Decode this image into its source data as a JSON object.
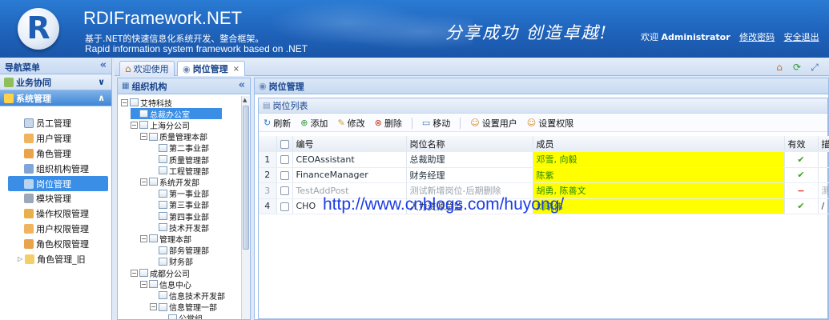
{
  "header": {
    "logo_letter": "R",
    "title": "RDIFramework.NET",
    "subtitle_cn": "基于.NET的快速信息化系统开发、整合框架。",
    "subtitle_en": "Rapid information system framework based on .NET",
    "slogan": "分享成功  创造卓越!",
    "welcome": "欢迎",
    "username": "Administrator",
    "change_password": "修改密码",
    "logout": "安全退出",
    "color": "#1f63bb"
  },
  "nav": {
    "title": "导航菜单",
    "collapse": "«",
    "groups": [
      {
        "label": "业务协同",
        "chev": "∨"
      },
      {
        "label": "系统管理",
        "chev": "∧"
      }
    ],
    "items": [
      {
        "label": "员工管理",
        "icon": "user-icon"
      },
      {
        "label": "用户管理",
        "icon": "user-icon"
      },
      {
        "label": "角色管理",
        "icon": "role-icon"
      },
      {
        "label": "组织机构管理",
        "icon": "org-icon"
      },
      {
        "label": "岗位管理",
        "icon": "post-icon"
      },
      {
        "label": "模块管理",
        "icon": "module-icon"
      },
      {
        "label": "操作权限管理",
        "icon": "permission-icon"
      },
      {
        "label": "用户权限管理",
        "icon": "user-icon"
      },
      {
        "label": "角色权限管理",
        "icon": "role-icon"
      },
      {
        "label": "角色管理_旧",
        "icon": "folder-icon"
      }
    ]
  },
  "tabs": [
    {
      "label": "欢迎使用"
    },
    {
      "label": "岗位管理",
      "close": "×"
    }
  ],
  "org": {
    "title": "组织机构",
    "collapse": "«",
    "nodes": [
      {
        "label": "艾特科技",
        "level": 0,
        "toggle": "−"
      },
      {
        "label": "总裁办公室",
        "level": 1,
        "selected": true
      },
      {
        "label": "上海分公司",
        "level": 1,
        "toggle": "−"
      },
      {
        "label": "质量管理本部",
        "level": 2,
        "toggle": "−"
      },
      {
        "label": "第二事业部",
        "level": 3
      },
      {
        "label": "质量管理部",
        "level": 3
      },
      {
        "label": "工程管理部",
        "level": 3
      },
      {
        "label": "系统开发部",
        "level": 2,
        "toggle": "−"
      },
      {
        "label": "第一事业部",
        "level": 3
      },
      {
        "label": "第三事业部",
        "level": 3
      },
      {
        "label": "第四事业部",
        "level": 3
      },
      {
        "label": "技术开发部",
        "level": 3
      },
      {
        "label": "管理本部",
        "level": 2,
        "toggle": "−"
      },
      {
        "label": "部务管理部",
        "level": 3
      },
      {
        "label": "财务部",
        "level": 3
      },
      {
        "label": "成都分公司",
        "level": 1,
        "toggle": "−"
      },
      {
        "label": "信息中心",
        "level": 2,
        "toggle": "−"
      },
      {
        "label": "信息技术开发部",
        "level": 3
      },
      {
        "label": "信息管理一部",
        "level": 3,
        "toggle": "−"
      },
      {
        "label": "公堂组",
        "level": 4
      }
    ]
  },
  "post": {
    "title": "岗位管理",
    "list_title": "岗位列表",
    "toolbar": [
      "刷新",
      "添加",
      "修改",
      "删除",
      "移动",
      "设置用户",
      "设置权限"
    ],
    "columns": [
      "编号",
      "岗位名称",
      "成员",
      "有效",
      "描"
    ],
    "rows": [
      {
        "num": "1",
        "code": "CEOAssistant",
        "name": "总裁助理",
        "members": "邓雪, 向毅",
        "valid": "✔",
        "desc": ""
      },
      {
        "num": "2",
        "code": "FinanceManager",
        "name": "财务经理",
        "members": "陈紫",
        "valid": "✔",
        "desc": ""
      },
      {
        "num": "3",
        "code": "TestAddPost",
        "name": "测试新增岗位-后期删除",
        "members": "胡勇, 陈善文",
        "valid": "−",
        "desc": "测",
        "disabled": true
      },
      {
        "num": "4",
        "code": "CHO",
        "name": "人力资源总监",
        "members": "刘晓伟",
        "valid": "✔",
        "desc": "/"
      }
    ]
  },
  "watermark": "http://www.cnblogs.com/huyong/"
}
